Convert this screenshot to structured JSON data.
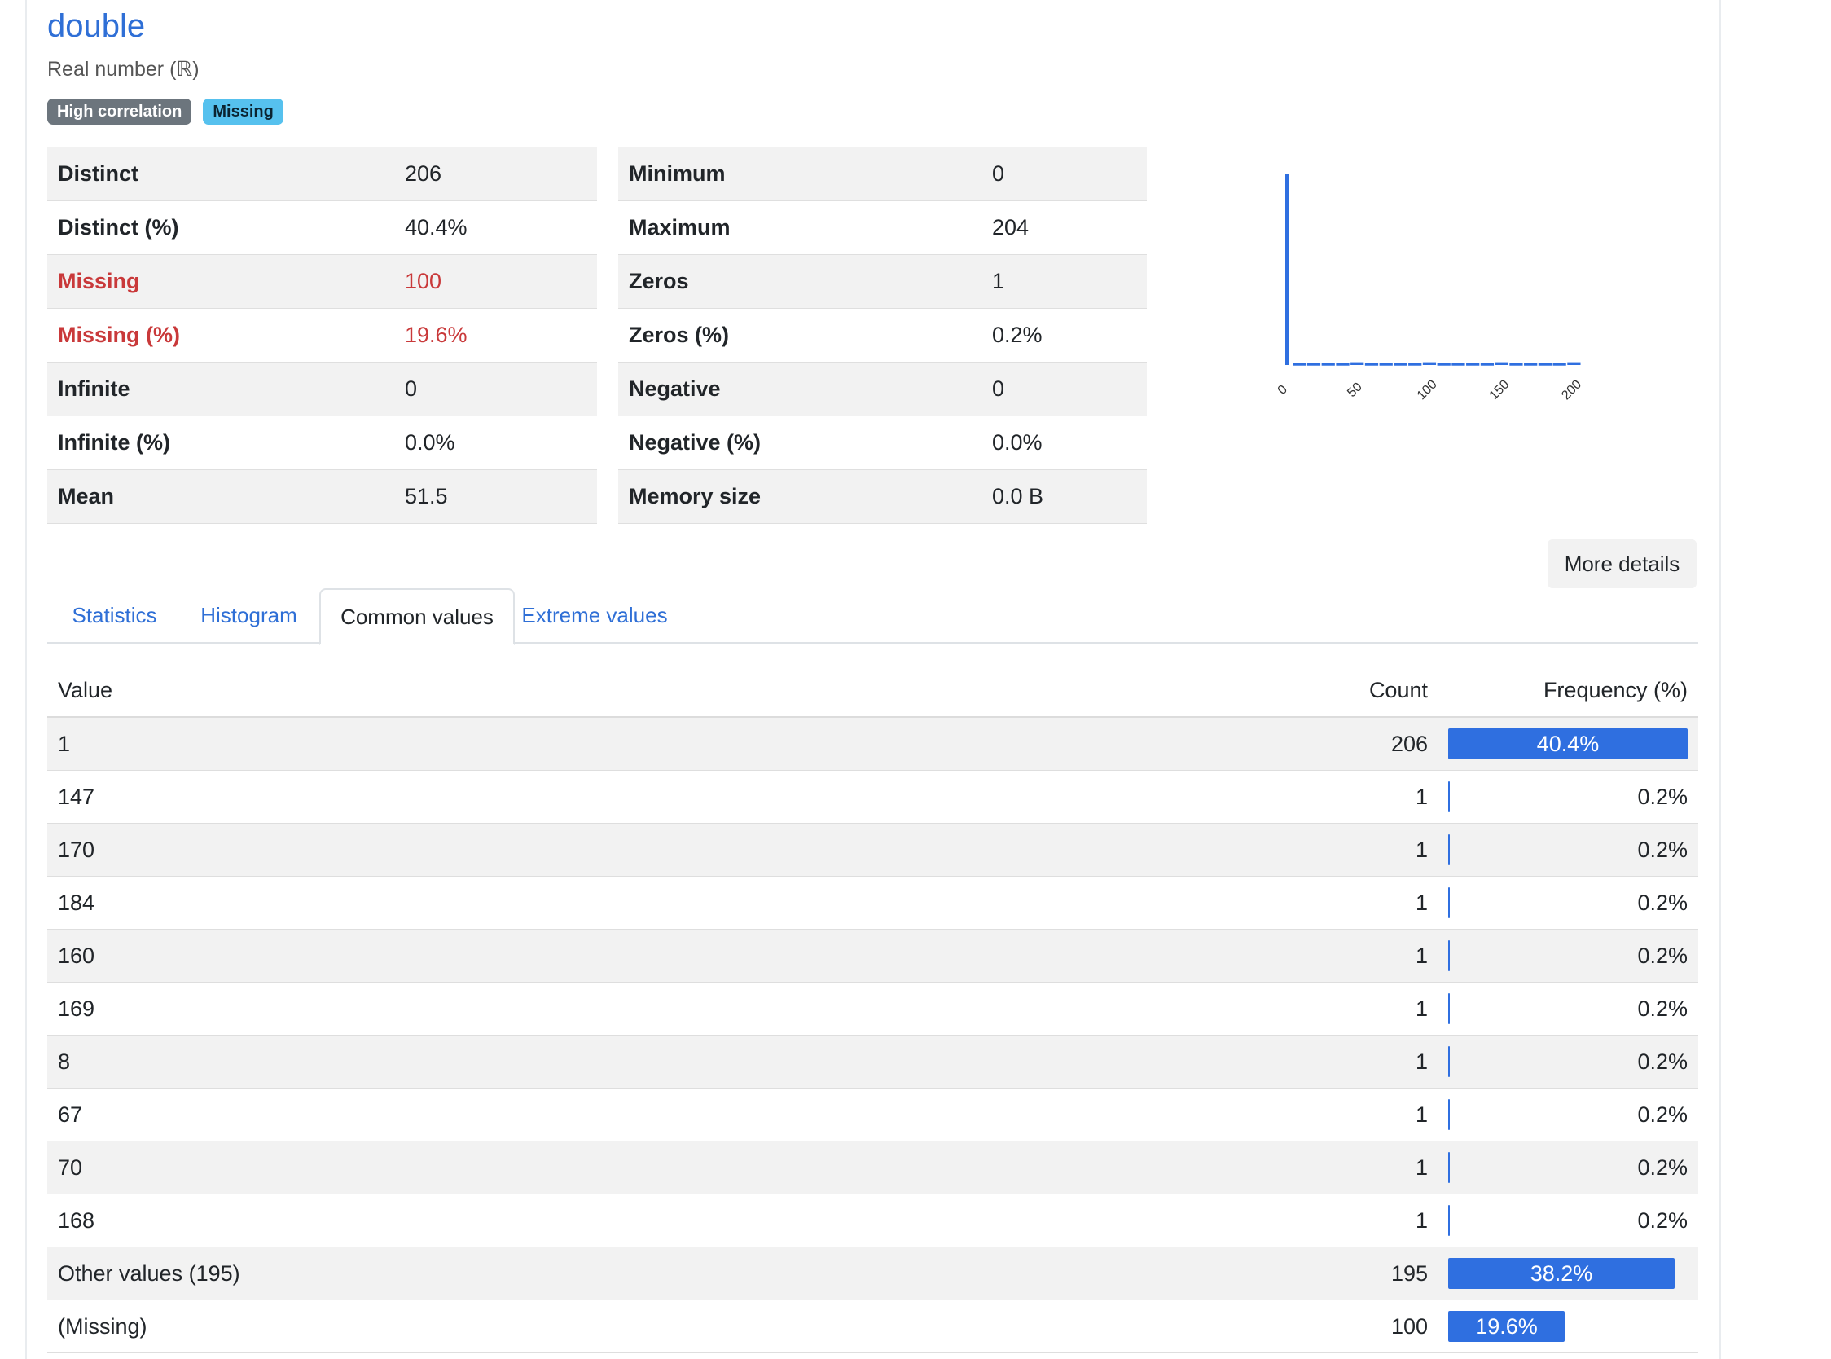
{
  "variable": {
    "name": "double",
    "type_label": "Real number (ℝ)",
    "badges": [
      "High correlation",
      "Missing"
    ]
  },
  "stats_left": [
    {
      "label": "Distinct",
      "value": "206",
      "warn": false
    },
    {
      "label": "Distinct (%)",
      "value": "40.4%",
      "warn": false
    },
    {
      "label": "Missing",
      "value": "100",
      "warn": true
    },
    {
      "label": "Missing (%)",
      "value": "19.6%",
      "warn": true
    },
    {
      "label": "Infinite",
      "value": "0",
      "warn": false
    },
    {
      "label": "Infinite (%)",
      "value": "0.0%",
      "warn": false
    },
    {
      "label": "Mean",
      "value": "51.5",
      "warn": false
    }
  ],
  "stats_right": [
    {
      "label": "Minimum",
      "value": "0"
    },
    {
      "label": "Maximum",
      "value": "204"
    },
    {
      "label": "Zeros",
      "value": "1"
    },
    {
      "label": "Zeros (%)",
      "value": "0.2%"
    },
    {
      "label": "Negative",
      "value": "0"
    },
    {
      "label": "Negative (%)",
      "value": "0.0%"
    },
    {
      "label": "Memory size",
      "value": "0.0 B"
    }
  ],
  "chart_data": {
    "type": "bar",
    "title": "",
    "xlabel": "",
    "ylabel": "",
    "xlim": [
      0,
      204
    ],
    "x_ticks": [
      "0",
      "50",
      "100",
      "150",
      "200"
    ],
    "grid": false,
    "legend": "none",
    "bar_color": "#2f6fe0",
    "bins": [
      {
        "x": 1,
        "count": 206
      },
      {
        "x": 10,
        "count": 2
      },
      {
        "x": 20,
        "count": 2
      },
      {
        "x": 30,
        "count": 2
      },
      {
        "x": 40,
        "count": 2
      },
      {
        "x": 50,
        "count": 3
      },
      {
        "x": 60,
        "count": 2
      },
      {
        "x": 70,
        "count": 2
      },
      {
        "x": 80,
        "count": 2
      },
      {
        "x": 90,
        "count": 2
      },
      {
        "x": 100,
        "count": 3
      },
      {
        "x": 110,
        "count": 2
      },
      {
        "x": 120,
        "count": 2
      },
      {
        "x": 130,
        "count": 2
      },
      {
        "x": 140,
        "count": 2
      },
      {
        "x": 150,
        "count": 3
      },
      {
        "x": 160,
        "count": 2
      },
      {
        "x": 170,
        "count": 2
      },
      {
        "x": 180,
        "count": 2
      },
      {
        "x": 190,
        "count": 2
      },
      {
        "x": 200,
        "count": 3
      }
    ]
  },
  "more_details_label": "More details",
  "tabs": [
    {
      "label": "Statistics",
      "active": false
    },
    {
      "label": "Histogram",
      "active": false
    },
    {
      "label": "Common values",
      "active": true
    },
    {
      "label": "Extreme values",
      "active": false
    }
  ],
  "common_values": {
    "headers": {
      "value": "Value",
      "count": "Count",
      "frequency": "Frequency (%)"
    },
    "rows": [
      {
        "value": "1",
        "count": "206",
        "freq": "40.4%",
        "pct": 40.4
      },
      {
        "value": "147",
        "count": "1",
        "freq": "0.2%",
        "pct": 0.2
      },
      {
        "value": "170",
        "count": "1",
        "freq": "0.2%",
        "pct": 0.2
      },
      {
        "value": "184",
        "count": "1",
        "freq": "0.2%",
        "pct": 0.2
      },
      {
        "value": "160",
        "count": "1",
        "freq": "0.2%",
        "pct": 0.2
      },
      {
        "value": "169",
        "count": "1",
        "freq": "0.2%",
        "pct": 0.2
      },
      {
        "value": "8",
        "count": "1",
        "freq": "0.2%",
        "pct": 0.2
      },
      {
        "value": "67",
        "count": "1",
        "freq": "0.2%",
        "pct": 0.2
      },
      {
        "value": "70",
        "count": "1",
        "freq": "0.2%",
        "pct": 0.2
      },
      {
        "value": "168",
        "count": "1",
        "freq": "0.2%",
        "pct": 0.2
      },
      {
        "value": "Other values (195)",
        "count": "195",
        "freq": "38.2%",
        "pct": 38.2
      },
      {
        "value": "(Missing)",
        "count": "100",
        "freq": "19.6%",
        "pct": 19.6
      }
    ]
  }
}
